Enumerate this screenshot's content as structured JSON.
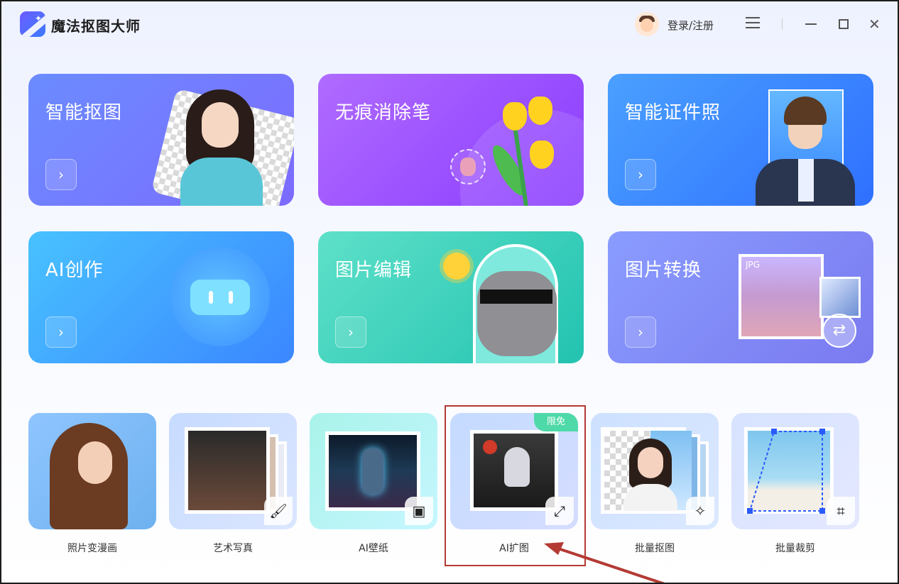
{
  "window": {
    "app_title": "魔法抠图大师",
    "login_label": "登录/注册",
    "menu_icon": "hamburger-icon",
    "min_icon": "minimize-icon",
    "max_icon": "maximize-icon",
    "close_icon": "close-icon"
  },
  "features": [
    {
      "title": "智能抠图",
      "icon": "chevron-right-icon",
      "go": "›"
    },
    {
      "title": "无痕消除笔",
      "icon": "chevron-right-icon",
      "go": "›"
    },
    {
      "title": "智能证件照",
      "icon": "chevron-right-icon",
      "go": "›"
    },
    {
      "title": "AI创作",
      "icon": "chevron-right-icon",
      "go": "›"
    },
    {
      "title": "图片编辑",
      "icon": "chevron-right-icon",
      "go": "›"
    },
    {
      "title": "图片转换",
      "icon": "chevron-right-icon",
      "go": "›"
    }
  ],
  "format_tag": "JPG",
  "tools": [
    {
      "label": "照片变漫画"
    },
    {
      "label": "艺术写真",
      "corner_icon": "brush-icon"
    },
    {
      "label": "AI壁纸",
      "corner_icon": "image-icon"
    },
    {
      "label": "AI扩图",
      "corner_icon": "expand-icon",
      "badge": "限免"
    },
    {
      "label": "批量抠图",
      "corner_icon": "magic-wand-icon"
    },
    {
      "label": "批量裁剪",
      "corner_icon": "crop-icon"
    }
  ],
  "colors": {
    "highlight_box": "#b43a33",
    "badge": "#4ed9a8"
  }
}
